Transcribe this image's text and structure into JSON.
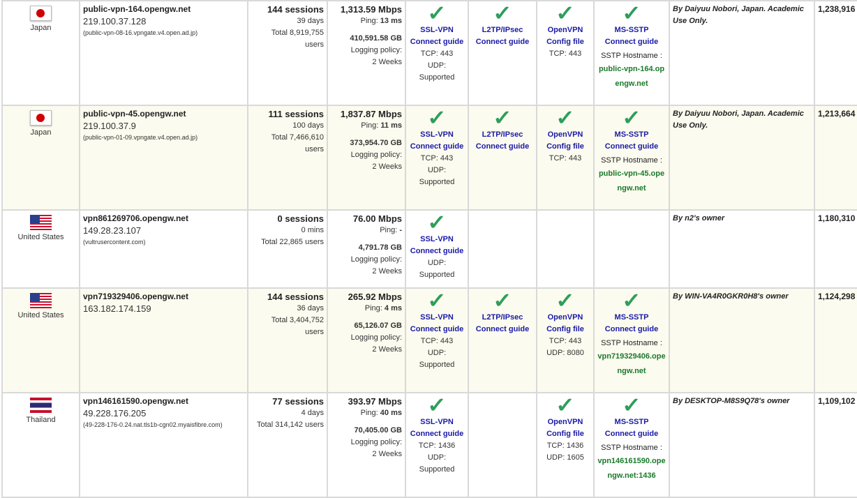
{
  "rows": [
    {
      "country": "Japan",
      "flag": "jp",
      "hostname": "public-vpn-164.opengw.net",
      "ip": "219.100.37.128",
      "rdns": "(public-vpn-08-16.vpngate.v4.open.ad.jp)",
      "sessions": "144 sessions",
      "uptime": "39 days",
      "total_users": "Total 8,919,755 users",
      "speed": "1,313.59 Mbps",
      "ping_label": "Ping:",
      "ping": "13 ms",
      "traffic": "410,591.58 GB",
      "logging_label": "Logging policy:",
      "logging": "2 Weeks",
      "ssl": {
        "label": "SSL-VPN",
        "link": "Connect guide",
        "tcp": "TCP: 443",
        "udp": "UDP: Supported"
      },
      "l2tp": {
        "label": "L2TP/IPsec",
        "link": "Connect guide"
      },
      "openvpn": {
        "label": "OpenVPN",
        "link": "Config file",
        "tcp": "TCP: 443",
        "udp": ""
      },
      "sstp": {
        "label": "MS-SSTP",
        "link": "Connect guide",
        "host_label": "SSTP Hostname :",
        "host": "public-vpn-164.opengw.net"
      },
      "operator": "By Daiyuu Nobori, Japan. Academic Use Only.",
      "score": "1,238,916"
    },
    {
      "country": "Japan",
      "flag": "jp",
      "hostname": "public-vpn-45.opengw.net",
      "ip": "219.100.37.9",
      "rdns": "(public-vpn-01-09.vpngate.v4.open.ad.jp)",
      "sessions": "111 sessions",
      "uptime": "100 days",
      "total_users": "Total 7,466,610 users",
      "speed": "1,837.87 Mbps",
      "ping_label": "Ping:",
      "ping": "11 ms",
      "traffic": "373,954.70 GB",
      "logging_label": "Logging policy:",
      "logging": "2 Weeks",
      "ssl": {
        "label": "SSL-VPN",
        "link": "Connect guide",
        "tcp": "TCP: 443",
        "udp": "UDP: Supported"
      },
      "l2tp": {
        "label": "L2TP/IPsec",
        "link": "Connect guide"
      },
      "openvpn": {
        "label": "OpenVPN",
        "link": "Config file",
        "tcp": "TCP: 443",
        "udp": ""
      },
      "sstp": {
        "label": "MS-SSTP",
        "link": "Connect guide",
        "host_label": "SSTP Hostname :",
        "host": "public-vpn-45.opengw.net"
      },
      "operator": "By Daiyuu Nobori, Japan. Academic Use Only.",
      "score": "1,213,664"
    },
    {
      "country": "United States",
      "flag": "us",
      "hostname": "vpn861269706.opengw.net",
      "ip": "149.28.23.107",
      "rdns": "(vultrusercontent.com)",
      "sessions": "0 sessions",
      "uptime": "0 mins",
      "total_users": "Total 22,865 users",
      "speed": "76.00 Mbps",
      "ping_label": "Ping:",
      "ping": "-",
      "traffic": "4,791.78 GB",
      "logging_label": "Logging policy:",
      "logging": "2 Weeks",
      "ssl": {
        "label": "SSL-VPN",
        "link": "Connect guide",
        "tcp": "",
        "udp": "UDP: Supported"
      },
      "l2tp": null,
      "openvpn": null,
      "sstp": null,
      "operator": "By n2's owner",
      "score": "1,180,310"
    },
    {
      "country": "United States",
      "flag": "us",
      "hostname": "vpn719329406.opengw.net",
      "ip": "163.182.174.159",
      "rdns": "",
      "sessions": "144 sessions",
      "uptime": "36 days",
      "total_users": "Total 3,404,752 users",
      "speed": "265.92 Mbps",
      "ping_label": "Ping:",
      "ping": "4 ms",
      "traffic": "65,126.07 GB",
      "logging_label": "Logging policy:",
      "logging": "2 Weeks",
      "ssl": {
        "label": "SSL-VPN",
        "link": "Connect guide",
        "tcp": "TCP: 443",
        "udp": "UDP: Supported"
      },
      "l2tp": {
        "label": "L2TP/IPsec",
        "link": "Connect guide"
      },
      "openvpn": {
        "label": "OpenVPN",
        "link": "Config file",
        "tcp": "TCP: 443",
        "udp": "UDP: 8080"
      },
      "sstp": {
        "label": "MS-SSTP",
        "link": "Connect guide",
        "host_label": "SSTP Hostname :",
        "host": "vpn719329406.opengw.net"
      },
      "operator": "By WIN-VA4R0GKR0H8's owner",
      "score": "1,124,298"
    },
    {
      "country": "Thailand",
      "flag": "th",
      "hostname": "vpn146161590.opengw.net",
      "ip": "49.228.176.205",
      "rdns": "(49-228-176-0.24.nat.tls1b-cgn02.myaisfibre.com)",
      "sessions": "77 sessions",
      "uptime": "4 days",
      "total_users": "Total 314,142 users",
      "speed": "393.97 Mbps",
      "ping_label": "Ping:",
      "ping": "40 ms",
      "traffic": "70,405.00 GB",
      "logging_label": "Logging policy:",
      "logging": "2 Weeks",
      "ssl": {
        "label": "SSL-VPN",
        "link": "Connect guide",
        "tcp": "TCP: 1436",
        "udp": "UDP: Supported"
      },
      "l2tp": null,
      "openvpn": {
        "label": "OpenVPN",
        "link": "Config file",
        "tcp": "TCP: 1436",
        "udp": "UDP: 1605"
      },
      "sstp": {
        "label": "MS-SSTP",
        "link": "Connect guide",
        "host_label": "SSTP Hostname :",
        "host": "vpn146161590.opengw.net:1436"
      },
      "operator": "By DESKTOP-M8S9Q78's owner",
      "score": "1,109,102"
    }
  ],
  "colors": {
    "link": "#1a1aa6",
    "check": "#2e9e5b",
    "sstp_host": "#1a7a2a",
    "alt_row": "#fbfbef",
    "border": "#d9d9d9"
  },
  "icons": {
    "check": "checkmark-icon"
  }
}
